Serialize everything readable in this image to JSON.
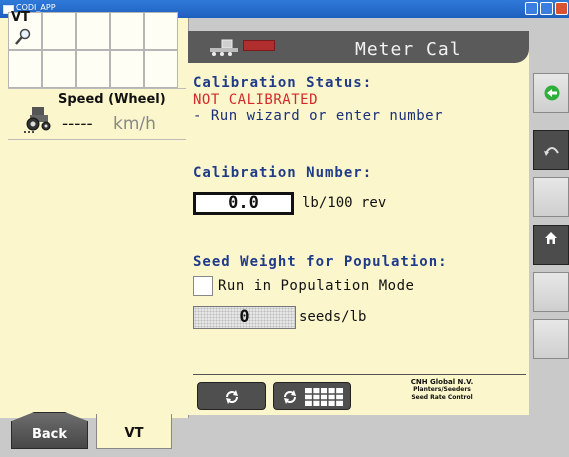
{
  "window": {
    "title": "CODI_APP"
  },
  "left": {
    "vt_label": "VT",
    "speed": {
      "label": "Speed (Wheel)",
      "value": "-----",
      "unit": "km/h"
    }
  },
  "header": {
    "title": "Meter Cal"
  },
  "calibration_status": {
    "label": "Calibration Status:",
    "value": "NOT CALIBRATED",
    "hint": "- Run wizard or enter number"
  },
  "calibration_number": {
    "label": "Calibration Number:",
    "value": "0.0",
    "unit": "lb/100 rev"
  },
  "seed_weight": {
    "label": "Seed Weight for Population:",
    "checkbox_label": "Run in Population Mode",
    "checkbox_checked": false,
    "value": "0",
    "unit": "seeds/lb"
  },
  "footer_info": {
    "line1": "CNH Global N.V.",
    "line2": "Planters/Seeders",
    "line3": "Seed Rate Control"
  },
  "tabs": {
    "back": "Back",
    "vt": "VT"
  },
  "colors": {
    "panel_bg": "#fbf6cc",
    "status_red": "#d22b2b",
    "label_blue": "#1f3b8a",
    "accept_green": "#2fae3c"
  },
  "icons": [
    "search-icon",
    "tractor-icon",
    "planter-icon",
    "refresh-icon",
    "grid-icon",
    "green-arrow-icon",
    "back-arrow-icon",
    "home-icon"
  ]
}
